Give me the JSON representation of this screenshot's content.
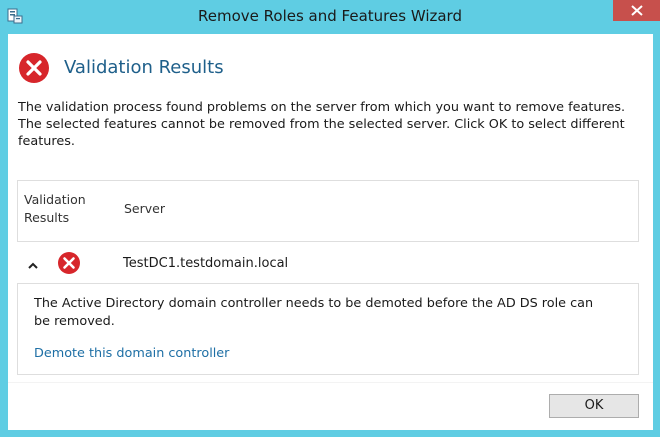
{
  "window": {
    "title": "Remove Roles and Features Wizard",
    "icons": {
      "app": "server-manager-icon",
      "close": "close-icon"
    }
  },
  "header": {
    "icon": "error-icon",
    "title": "Validation Results"
  },
  "description": {
    "line1": "The validation process found problems on the server from which you want to remove features.",
    "line2": "The selected features cannot be removed from the selected server.  Click OK to select different",
    "line3": "features."
  },
  "table": {
    "columns": {
      "validation_results_line1": "Validation",
      "validation_results_line2": "Results",
      "server": "Server"
    },
    "rows": [
      {
        "status_icon": "error-icon",
        "expand_icon": "chevron-up-icon",
        "server": "TestDC1.testdomain.local",
        "message_line1": "The Active Directory domain controller needs to be demoted before the AD DS role can",
        "message_line2": "be removed.",
        "link": "Demote this domain controller"
      }
    ]
  },
  "footer": {
    "ok_label": "OK"
  },
  "colors": {
    "titlebar": "#5fcde3",
    "close_button": "#c7504c",
    "error_red": "#d7262b",
    "heading_blue": "#1e5f8a",
    "link_blue": "#1e6fa5"
  }
}
